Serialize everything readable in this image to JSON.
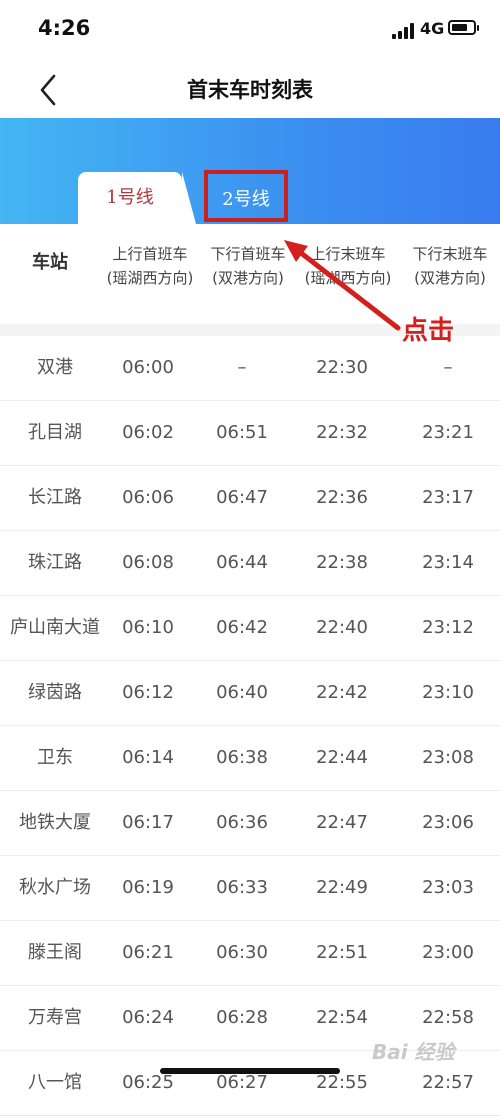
{
  "status_bar": {
    "time": "4:26",
    "network": "4G",
    "battery_level": 0.75
  },
  "nav": {
    "title": "首末车时刻表",
    "back_icon": "chevron-left-icon"
  },
  "tabs": [
    {
      "label": "1号线",
      "selected": true,
      "color": "#b3363a"
    },
    {
      "label": "2号线",
      "selected": false,
      "color": "#ffffff"
    }
  ],
  "header_gradient": [
    "#44b6f3",
    "#3a7cf0"
  ],
  "columns": {
    "station": "车站",
    "heads": [
      [
        "上行首班车",
        "(瑶湖西方向)"
      ],
      [
        "下行首班车",
        "(双港方向)"
      ],
      [
        "上行末班车",
        "(瑶湖西方向)"
      ],
      [
        "下行末班车",
        "(双港方向)"
      ]
    ]
  },
  "rows": [
    {
      "station": "双港",
      "up_first": "06:00",
      "down_first": "–",
      "up_last": "22:30",
      "down_last": "–"
    },
    {
      "station": "孔目湖",
      "up_first": "06:02",
      "down_first": "06:51",
      "up_last": "22:32",
      "down_last": "23:21"
    },
    {
      "station": "长江路",
      "up_first": "06:06",
      "down_first": "06:47",
      "up_last": "22:36",
      "down_last": "23:17"
    },
    {
      "station": "珠江路",
      "up_first": "06:08",
      "down_first": "06:44",
      "up_last": "22:38",
      "down_last": "23:14"
    },
    {
      "station": "庐山南大道",
      "up_first": "06:10",
      "down_first": "06:42",
      "up_last": "22:40",
      "down_last": "23:12"
    },
    {
      "station": "绿茵路",
      "up_first": "06:12",
      "down_first": "06:40",
      "up_last": "22:42",
      "down_last": "23:10"
    },
    {
      "station": "卫东",
      "up_first": "06:14",
      "down_first": "06:38",
      "up_last": "22:44",
      "down_last": "23:08"
    },
    {
      "station": "地铁大厦",
      "up_first": "06:17",
      "down_first": "06:36",
      "up_last": "22:47",
      "down_last": "23:06"
    },
    {
      "station": "秋水广场",
      "up_first": "06:19",
      "down_first": "06:33",
      "up_last": "22:49",
      "down_last": "23:03"
    },
    {
      "station": "滕王阁",
      "up_first": "06:21",
      "down_first": "06:30",
      "up_last": "22:51",
      "down_last": "23:00"
    },
    {
      "station": "万寿宫",
      "up_first": "06:24",
      "down_first": "06:28",
      "up_last": "22:54",
      "down_last": "22:58"
    },
    {
      "station": "八一馆",
      "up_first": "06:25",
      "down_first": "06:27",
      "up_last": "22:55",
      "down_last": "22:57"
    }
  ],
  "annotation": {
    "text": "点击",
    "color": "#d41f1c"
  },
  "watermark": "Bai 经验"
}
